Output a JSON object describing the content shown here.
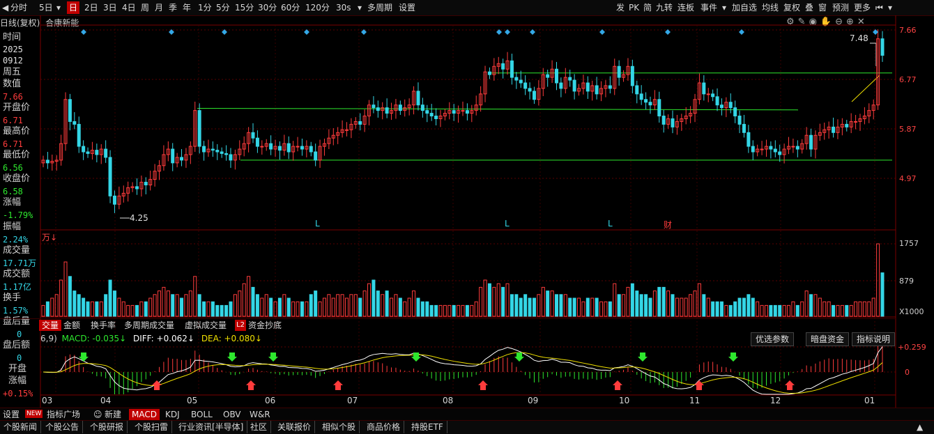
{
  "toolbar": {
    "left_items": [
      "分时",
      "5日",
      "日",
      "2日",
      "3日",
      "4日",
      "周",
      "月",
      "季",
      "年",
      "1分",
      "5分",
      "15分",
      "30分",
      "60分",
      "120分",
      "30s",
      "多周期",
      "设置"
    ],
    "selected": "日",
    "right_items": [
      "发",
      "PK",
      "简",
      "九转",
      "连板",
      "事件",
      "加自选",
      "均线",
      "复权",
      "叠",
      "窗",
      "预测",
      "更多"
    ]
  },
  "chart_header": {
    "period": "日线(复权)",
    "stock_name": "合康新能"
  },
  "info_panel": {
    "time_label": "时间",
    "year": "2025",
    "date": "0912",
    "weekday": "周五",
    "value_label": "数值",
    "value": "7.66",
    "open_label": "开盘价",
    "open": "6.71",
    "high_label": "最高价",
    "high": "6.71",
    "low_label": "最低价",
    "low": "6.56",
    "close_label": "收盘价",
    "close": "6.58",
    "change_label": "涨幅",
    "change": "-1.79%",
    "amplitude_label": "振幅",
    "amplitude": "2.24%",
    "volume_label": "成交量",
    "volume": "17.71万",
    "amount_label": "成交额",
    "amount": "1.17亿",
    "turnover_label": "换手",
    "turnover": "1.57%",
    "after_vol_label": "盘后量",
    "after_vol": "0",
    "after_amt_label": "盘后额",
    "after_amt": "0",
    "open_pct_label": "开盘",
    "open_pct_label2": "涨幅",
    "open_pct": "+0.15%"
  },
  "price_axis": [
    "7.66",
    "6.77",
    "5.87",
    "4.97"
  ],
  "price_annotations": {
    "high_label": "7.48",
    "low_label": "4.25",
    "markers": [
      "L",
      "L",
      "L",
      "财"
    ]
  },
  "volume": {
    "unit_label": "万↓",
    "axis": [
      "1757",
      "879"
    ],
    "multiplier": "X1000"
  },
  "volume_tabs": [
    "交量",
    "金额",
    "换手率",
    "多周期成交量",
    "虚拟成交量",
    "L2",
    "资金抄底"
  ],
  "macd": {
    "params": "6,9)",
    "macd_label": "MACD: -0.035↓",
    "diff_label": "DIFF: +0.062↓",
    "dea_label": "DEA: +0.080↓",
    "axis": [
      "+0.259",
      "0"
    ],
    "buttons": [
      "优选参数",
      "暗盘资金",
      "指标说明"
    ]
  },
  "months": [
    "03",
    "04",
    "05",
    "06",
    "07",
    "08",
    "09",
    "10",
    "11",
    "12",
    "01"
  ],
  "indicator_tabs": [
    "设置",
    "NEW",
    "指标广场",
    "新建",
    "MACD",
    "KDJ",
    "BOLL",
    "OBV",
    "W&R"
  ],
  "bottom_tabs": [
    "个股新闻",
    "个股公告",
    "个股研报",
    "个股扫雷",
    "行业资讯[半导体]",
    "社区",
    "关联报价",
    "相似个股",
    "商品价格",
    "持股ETF"
  ],
  "colors": {
    "up": "#ff3c3c",
    "down": "#34d6e6",
    "support": "#2ee82e",
    "selected_tab": "#c00000"
  },
  "chart_data": {
    "type": "candlestick",
    "note_axis": "price axis 7.66/6.77/5.87/4.97; months 03..01",
    "closes": [
      5.3,
      5.25,
      5.28,
      5.3,
      5.6,
      6.4,
      6.0,
      5.95,
      5.55,
      5.45,
      5.42,
      5.48,
      5.4,
      5.5,
      5.35,
      4.65,
      4.5,
      4.65,
      4.7,
      4.8,
      4.82,
      4.78,
      4.9,
      4.85,
      4.95,
      5.1,
      5.2,
      5.4,
      5.5,
      5.25,
      5.35,
      5.3,
      5.4,
      5.55,
      6.2,
      5.55,
      5.45,
      5.5,
      5.48,
      5.45,
      5.42,
      5.4,
      5.3,
      5.4,
      5.5,
      5.6,
      5.8,
      5.7,
      5.55,
      5.55,
      5.6,
      5.5,
      5.55,
      5.48,
      5.6,
      5.45,
      5.55,
      5.55,
      5.5,
      5.55,
      5.45,
      5.3,
      5.55,
      5.6,
      5.7,
      5.75,
      5.8,
      5.85,
      5.85,
      5.95,
      6.0,
      5.95,
      6.1,
      6.3,
      6.25,
      6.2,
      6.25,
      6.15,
      6.2,
      6.3,
      6.2,
      6.25,
      6.3,
      6.55,
      6.3,
      6.2,
      6.15,
      6.1,
      6.05,
      6.1,
      6.15,
      6.2,
      6.15,
      6.2,
      6.2,
      6.15,
      6.2,
      6.3,
      6.5,
      6.9,
      6.85,
      7.0,
      7.05,
      6.95,
      7.1,
      6.8,
      6.75,
      6.7,
      6.6,
      6.55,
      6.4,
      6.6,
      6.85,
      6.8,
      6.95,
      6.7,
      6.6,
      6.8,
      6.75,
      6.55,
      6.6,
      6.7,
      6.55,
      6.65,
      6.5,
      6.6,
      6.65,
      6.6,
      7.0,
      6.8,
      6.85,
      7.0,
      6.65,
      6.5,
      6.4,
      6.35,
      6.3,
      6.4,
      6.1,
      5.95,
      6.05,
      5.9,
      6.0,
      6.05,
      6.1,
      6.15,
      6.4,
      6.7,
      6.5,
      6.5,
      6.45,
      6.3,
      6.25,
      6.35,
      6.25,
      6.1,
      5.95,
      5.8,
      5.55,
      5.45,
      5.5,
      5.5,
      5.55,
      5.5,
      5.45,
      5.4,
      5.5,
      5.55,
      5.55,
      5.5,
      5.6,
      5.75,
      5.5,
      5.75,
      5.8,
      5.85,
      5.9,
      5.8,
      5.9,
      5.95,
      5.9,
      6.0,
      6.0,
      6.05,
      6.1,
      6.2,
      6.3,
      7.5,
      7.2
    ],
    "volume_levels": [
      0.15,
      0.2,
      0.25,
      0.3,
      0.5,
      0.75,
      0.55,
      0.35,
      0.3,
      0.25,
      0.2,
      0.2,
      0.2,
      0.2,
      0.3,
      0.5,
      0.35,
      0.25,
      0.2,
      0.15,
      0.15,
      0.15,
      0.2,
      0.2,
      0.25,
      0.3,
      0.35,
      0.4,
      0.35,
      0.3,
      0.3,
      0.25,
      0.3,
      0.35,
      0.55,
      0.3,
      0.2,
      0.2,
      0.2,
      0.15,
      0.15,
      0.15,
      0.2,
      0.3,
      0.35,
      0.45,
      0.55,
      0.4,
      0.3,
      0.25,
      0.3,
      0.25,
      0.2,
      0.25,
      0.3,
      0.25,
      0.2,
      0.2,
      0.2,
      0.2,
      0.3,
      0.35,
      0.2,
      0.25,
      0.3,
      0.25,
      0.3,
      0.3,
      0.25,
      0.3,
      0.3,
      0.25,
      0.35,
      0.45,
      0.5,
      0.35,
      0.3,
      0.35,
      0.25,
      0.3,
      0.25,
      0.2,
      0.25,
      0.35,
      0.25,
      0.2,
      0.2,
      0.15,
      0.15,
      0.15,
      0.15,
      0.15,
      0.15,
      0.15,
      0.15,
      0.15,
      0.15,
      0.2,
      0.4,
      0.5,
      0.45,
      0.4,
      0.45,
      0.4,
      0.45,
      0.3,
      0.3,
      0.25,
      0.3,
      0.25,
      0.25,
      0.3,
      0.4,
      0.35,
      0.35,
      0.3,
      0.3,
      0.3,
      0.25,
      0.25,
      0.25,
      0.2,
      0.25,
      0.25,
      0.25,
      0.2,
      0.2,
      0.2,
      0.45,
      0.3,
      0.3,
      0.4,
      0.45,
      0.35,
      0.3,
      0.3,
      0.25,
      0.35,
      0.4,
      0.4,
      0.35,
      0.3,
      0.25,
      0.25,
      0.25,
      0.3,
      0.35,
      0.45,
      0.3,
      0.25,
      0.2,
      0.2,
      0.2,
      0.15,
      0.15,
      0.2,
      0.25,
      0.25,
      0.3,
      0.25,
      0.2,
      0.15,
      0.15,
      0.15,
      0.15,
      0.15,
      0.15,
      0.15,
      0.2,
      0.15,
      0.2,
      0.35,
      0.3,
      0.3,
      0.25,
      0.2,
      0.2,
      0.15,
      0.15,
      0.15,
      0.15,
      0.15,
      0.2,
      0.2,
      0.2,
      0.2,
      0.25,
      1.0,
      0.6
    ],
    "support_lines": [
      {
        "price": 6.9
      },
      {
        "price": 6.25
      },
      {
        "price": 5.3
      }
    ]
  }
}
